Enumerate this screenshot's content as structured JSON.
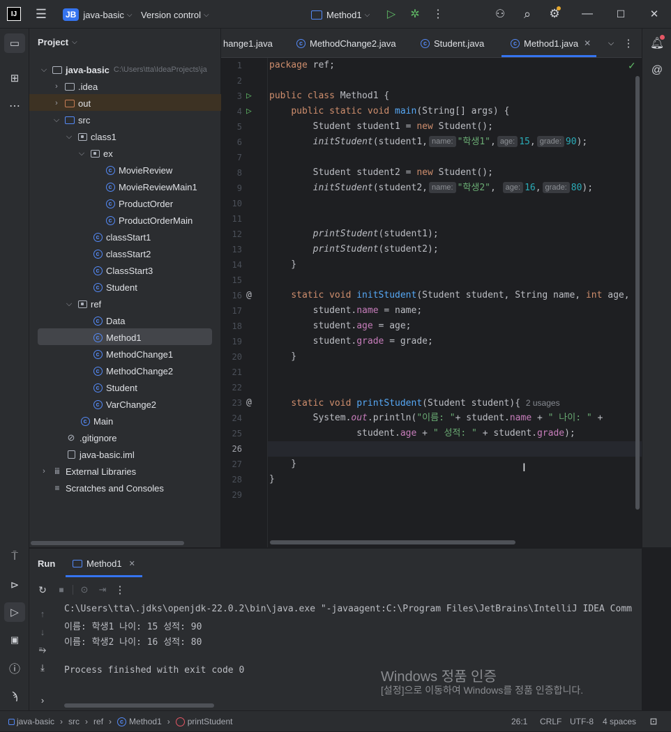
{
  "topbar": {
    "project_badge": "JB",
    "project_name": "java-basic",
    "vcs_label": "Version control",
    "run_config": "Method1"
  },
  "project_panel": {
    "title": "Project",
    "root_name": "java-basic",
    "root_path": "C:\\Users\\tta\\IdeaProjects\\ja",
    "items": [
      {
        "label": "java-basic"
      },
      {
        "label": ".idea"
      },
      {
        "label": "out"
      },
      {
        "label": "src"
      },
      {
        "label": "class1"
      },
      {
        "label": "ex"
      },
      {
        "label": "MovieReview"
      },
      {
        "label": "MovieReviewMain1"
      },
      {
        "label": "ProductOrder"
      },
      {
        "label": "ProductOrderMain"
      },
      {
        "label": "classStart1"
      },
      {
        "label": "classStart2"
      },
      {
        "label": "ClassStart3"
      },
      {
        "label": "Student"
      },
      {
        "label": "ref"
      },
      {
        "label": "Data"
      },
      {
        "label": "Method1"
      },
      {
        "label": "MethodChange1"
      },
      {
        "label": "MethodChange2"
      },
      {
        "label": "Student"
      },
      {
        "label": "VarChange2"
      },
      {
        "label": "Main"
      },
      {
        "label": ".gitignore"
      },
      {
        "label": "java-basic.iml"
      },
      {
        "label": "External Libraries"
      },
      {
        "label": "Scratches and Consoles"
      }
    ]
  },
  "editor": {
    "tabs": [
      {
        "label": "hange1.java"
      },
      {
        "label": "MethodChange2.java"
      },
      {
        "label": "Student.java"
      },
      {
        "label": "Method1.java"
      }
    ],
    "line_numbers": [
      "1",
      "2",
      "3",
      "4",
      "5",
      "6",
      "7",
      "8",
      "9",
      "10",
      "11",
      "12",
      "13",
      "14",
      "15",
      "16",
      "17",
      "18",
      "19",
      "20",
      "21",
      "22",
      "23",
      "24",
      "25",
      "26",
      "27",
      "28",
      "29"
    ],
    "usages_hint": "2 usages",
    "hints": {
      "name": "name:",
      "age": "age:",
      "grade": "grade:"
    }
  },
  "run_panel": {
    "title": "Run",
    "tab_label": "Method1",
    "console": [
      "C:\\Users\\tta\\.jdks\\openjdk-22.0.2\\bin\\java.exe \"-javaagent:C:\\Program Files\\JetBrains\\IntelliJ IDEA Comm",
      "이름: 학생1 나이: 15 성적: 90",
      "이름: 학생2 나이: 16 성적: 80",
      "",
      "Process finished with exit code 0"
    ],
    "watermark_title": "Windows 정품 인증",
    "watermark_sub": "[설정]으로 이동하여 Windows를 정품 인증합니다."
  },
  "statusbar": {
    "breadcrumb": [
      "java-basic",
      "src",
      "ref",
      "Method1",
      "printStudent"
    ],
    "position": "26:1",
    "line_sep": "CRLF",
    "encoding": "UTF-8",
    "indent": "4 spaces"
  }
}
